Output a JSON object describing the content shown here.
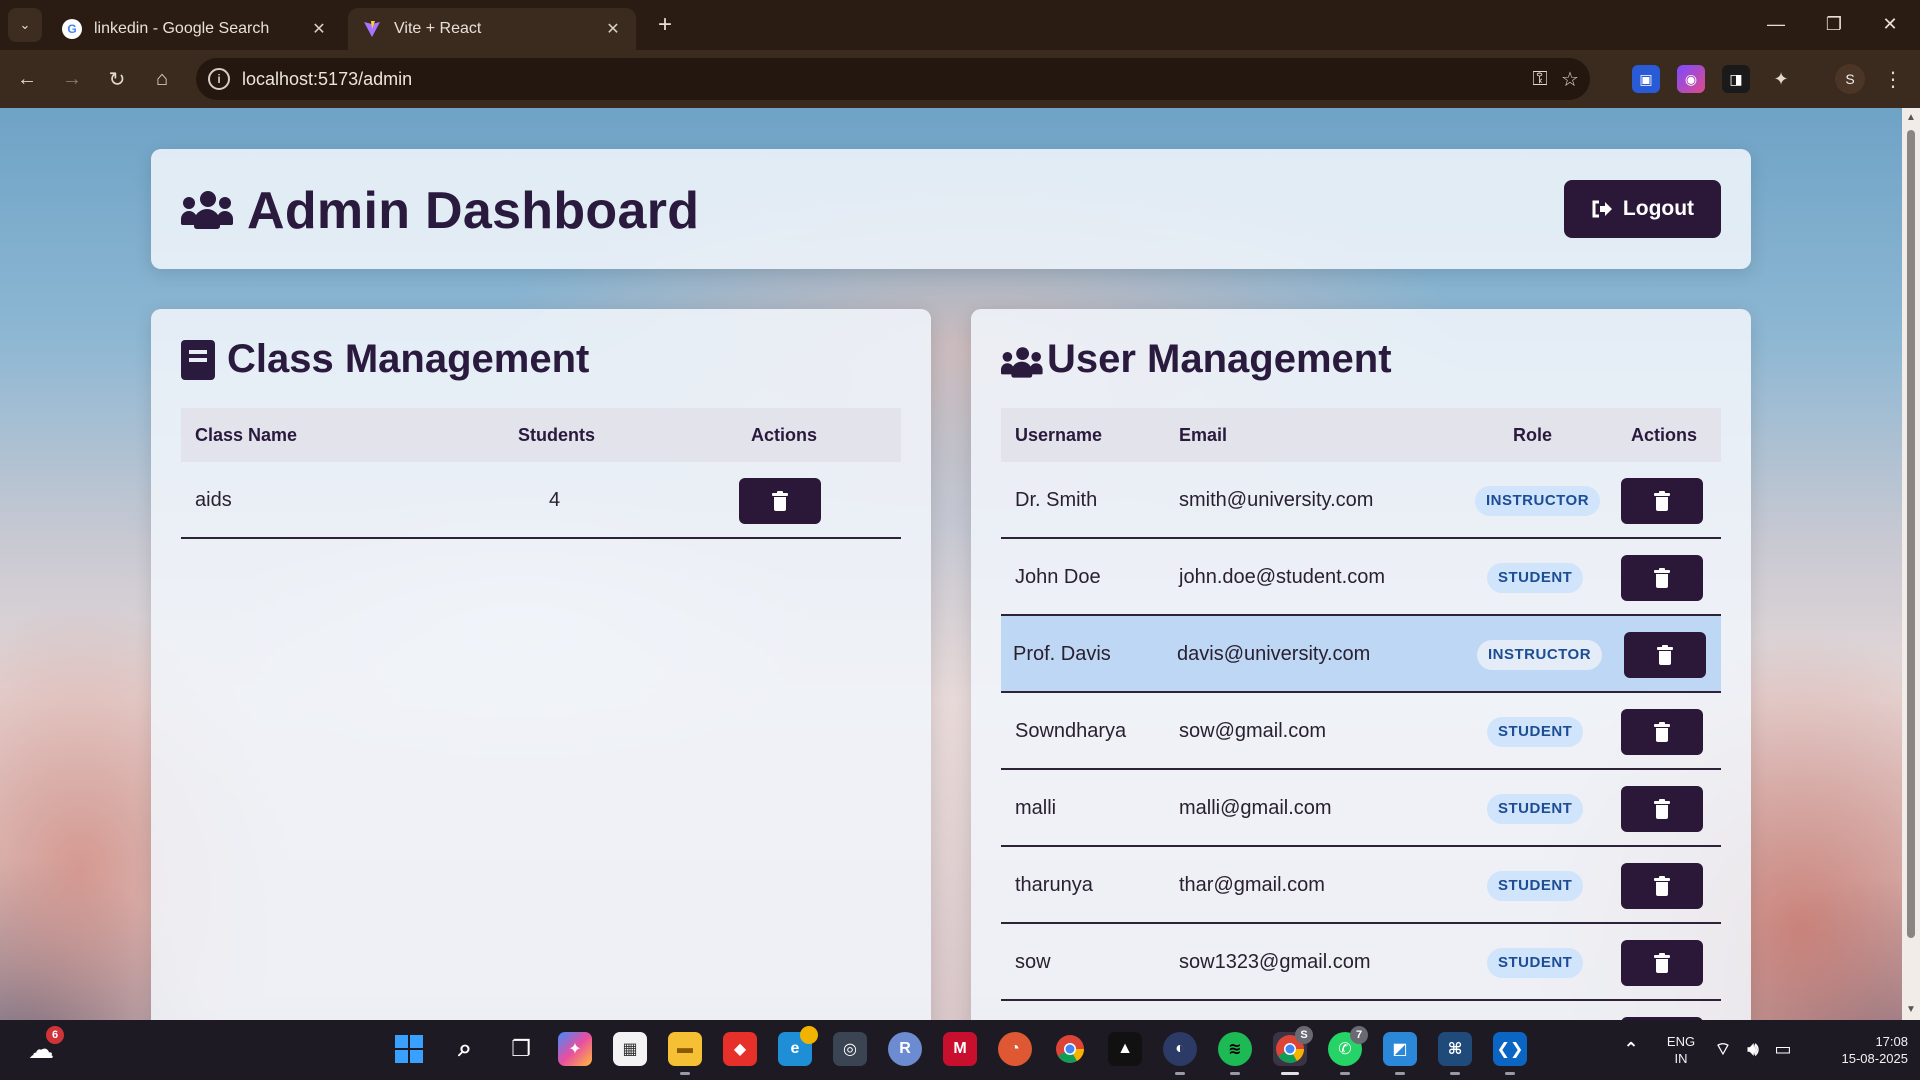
{
  "browser": {
    "tabs": [
      {
        "title": "linkedin - Google Search",
        "active": false,
        "favicon": "google-icon"
      },
      {
        "title": "Vite + React",
        "active": true,
        "favicon": "vite-icon"
      }
    ],
    "url": "localhost:5173/admin"
  },
  "header": {
    "title": "Admin Dashboard",
    "logout_label": "Logout"
  },
  "class_management": {
    "title": "Class Management",
    "columns": [
      "Class Name",
      "Students",
      "Actions"
    ],
    "rows": [
      {
        "class_name": "aids",
        "students": "4"
      }
    ]
  },
  "user_management": {
    "title": "User Management",
    "columns": [
      "Username",
      "Email",
      "Role",
      "Actions"
    ],
    "rows": [
      {
        "username": "Dr. Smith",
        "email": "smith@university.com",
        "role": "INSTRUCTOR"
      },
      {
        "username": "John Doe",
        "email": "john.doe@student.com",
        "role": "STUDENT"
      },
      {
        "username": "Prof. Davis",
        "email": "davis@university.com",
        "role": "INSTRUCTOR",
        "highlighted": true
      },
      {
        "username": "Sowndharya",
        "email": "sow@gmail.com",
        "role": "STUDENT"
      },
      {
        "username": "malli",
        "email": "malli@gmail.com",
        "role": "STUDENT"
      },
      {
        "username": "tharunya",
        "email": "thar@gmail.com",
        "role": "STUDENT"
      },
      {
        "username": "sow",
        "email": "sow1323@gmail.com",
        "role": "STUDENT"
      }
    ]
  },
  "taskbar": {
    "weather_badge": "6",
    "chrome_badge": "S",
    "whatsapp_badge": "7",
    "language": "ENG",
    "region": "IN",
    "time": "17:08",
    "date": "15-08-2025"
  },
  "colors": {
    "primary": "#2b1838",
    "badge_bg": "#d0e4fb",
    "badge_text": "#1d4d93",
    "highlight_row": "#b4d2f5"
  }
}
